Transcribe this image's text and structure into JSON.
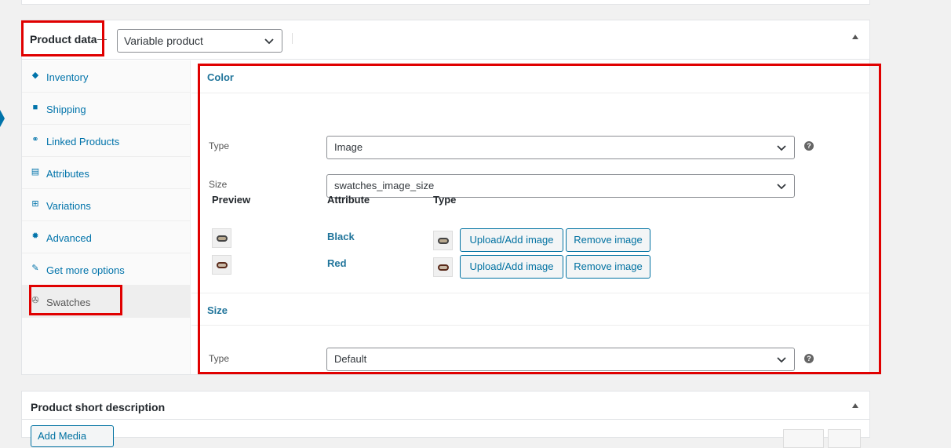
{
  "product_data": {
    "title": "Product data",
    "product_type": "Variable product",
    "tabs": [
      {
        "label": "Inventory",
        "icon": "tag-icon"
      },
      {
        "label": "Shipping",
        "icon": "truck-icon"
      },
      {
        "label": "Linked Products",
        "icon": "link-icon"
      },
      {
        "label": "Attributes",
        "icon": "list-icon"
      },
      {
        "label": "Variations",
        "icon": "grid-icon"
      },
      {
        "label": "Advanced",
        "icon": "gear-icon"
      },
      {
        "label": "Get more options",
        "icon": "plugin-icon"
      },
      {
        "label": "Swatches",
        "icon": "wrench-icon"
      }
    ],
    "active_tab": "Swatches"
  },
  "swatches": {
    "color": {
      "title": "Color",
      "type_label": "Type",
      "type_value": "Image",
      "size_label": "Size",
      "size_value": "swatches_image_size",
      "headers": {
        "preview": "Preview",
        "attribute": "Attribute",
        "type": "Type"
      },
      "rows": [
        {
          "attribute": "Black"
        },
        {
          "attribute": "Red"
        }
      ],
      "upload_label": "Upload/Add image",
      "remove_label": "Remove image"
    },
    "size": {
      "title": "Size",
      "type_label": "Type",
      "type_value": "Default"
    },
    "help_glyph": "?"
  },
  "short_description": {
    "title": "Product short description",
    "add_media": "Add Media"
  },
  "colors": {
    "highlight": "#e00000",
    "link": "#0073aa"
  }
}
